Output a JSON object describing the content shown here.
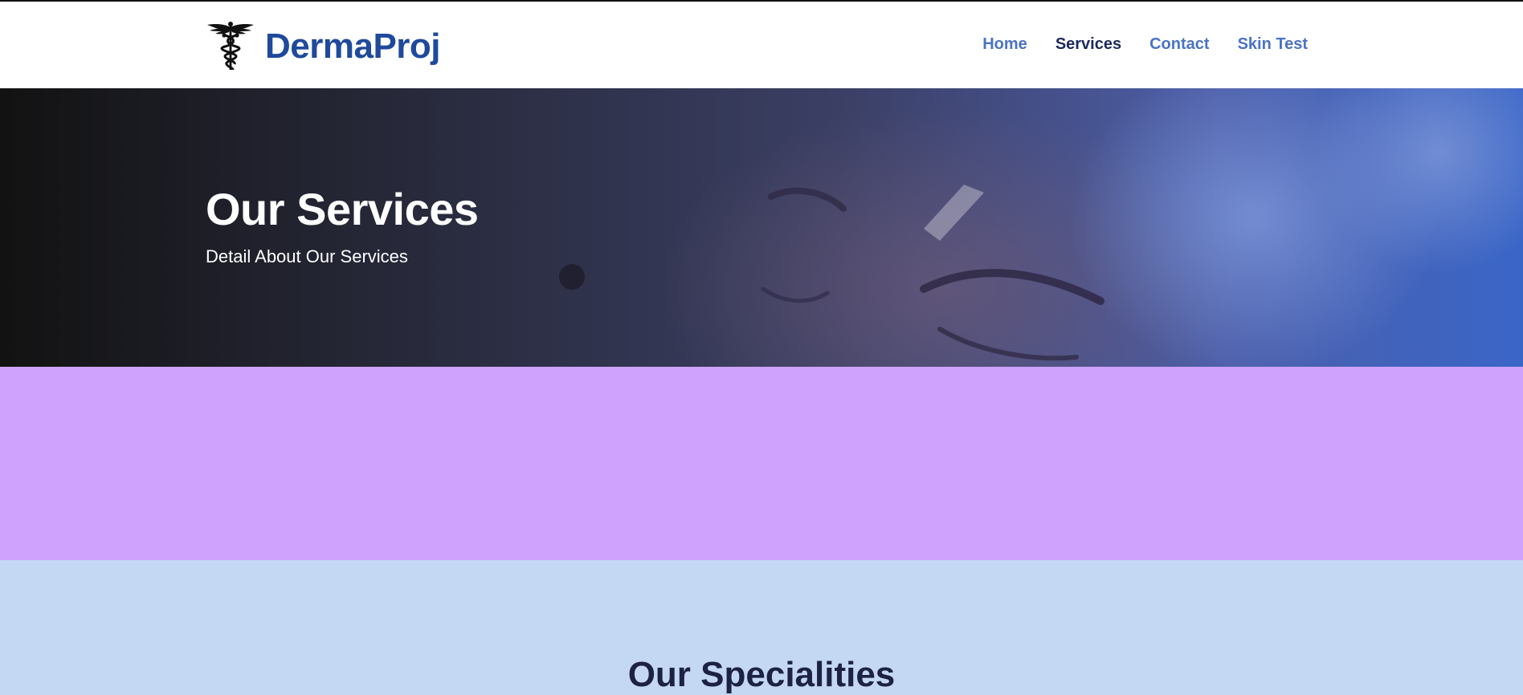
{
  "brand": {
    "name": "DermaProj",
    "logo_icon": "caduceus-icon"
  },
  "nav": {
    "items": [
      {
        "label": "Home",
        "active": false
      },
      {
        "label": "Services",
        "active": true
      },
      {
        "label": "Contact",
        "active": false
      },
      {
        "label": "Skin Test",
        "active": false
      }
    ]
  },
  "hero": {
    "title": "Our Services",
    "subtitle": "Detail About Our Services",
    "image": "facial-treatment-photo"
  },
  "specialities": {
    "title": "Our Specialities"
  },
  "colors": {
    "brand": "#1f4a9c",
    "nav_link": "#4b73c4",
    "nav_active": "#1c2a5c",
    "purple_band": "#cfa2fd",
    "specialities_bg": "#c4d8f3",
    "heading_dark": "#1d2244"
  }
}
